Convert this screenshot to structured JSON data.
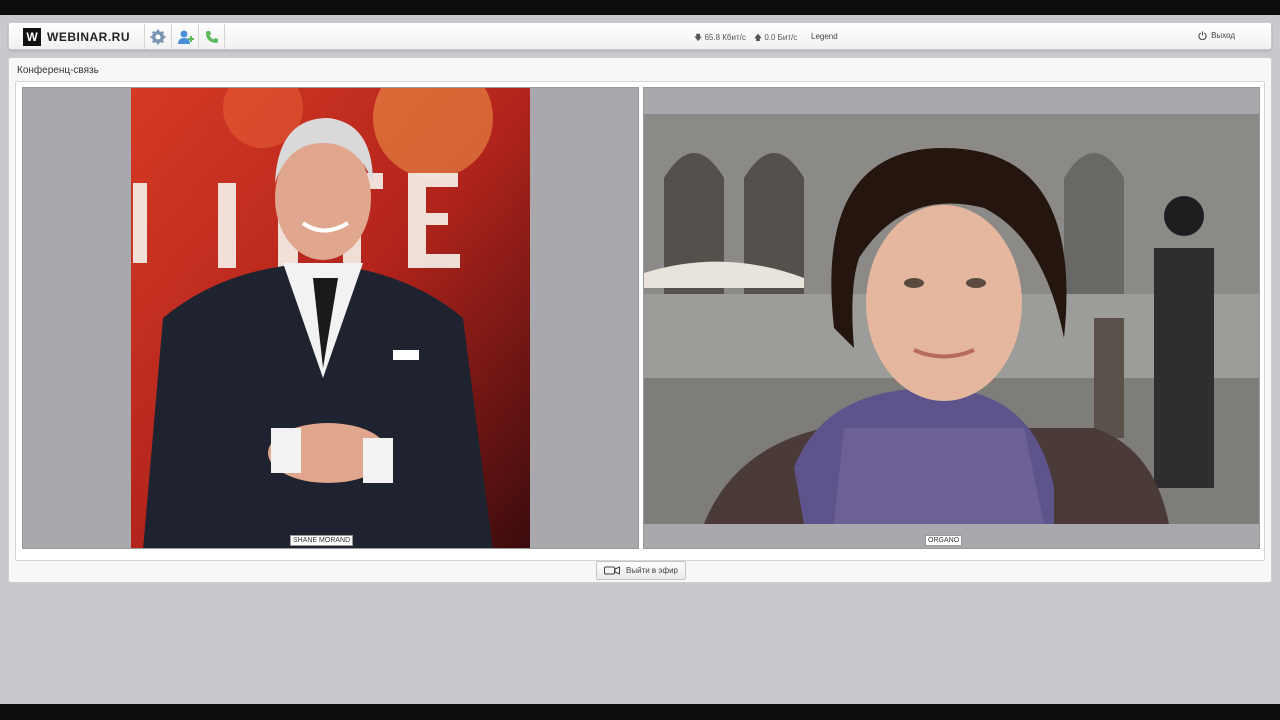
{
  "header": {
    "logo_letter": "W",
    "brand": "WEBINAR.RU",
    "tools": [
      {
        "icon": "gear-icon"
      },
      {
        "icon": "add-user-icon"
      },
      {
        "icon": "phone-icon"
      }
    ],
    "download_rate": "65.8 Кбит/с",
    "upload_rate": "0.0 Бит/с",
    "legend_label": "Legend",
    "logout_label": "Выход"
  },
  "panel": {
    "title": "Конференц-связь",
    "participants": [
      {
        "name": "SHANE MORAND"
      },
      {
        "name": "ORGANO"
      }
    ],
    "broadcast_button": "Выйти в эфир"
  },
  "colors": {
    "accent_blue": "#4a90d9",
    "accent_green": "#5cb85c"
  }
}
